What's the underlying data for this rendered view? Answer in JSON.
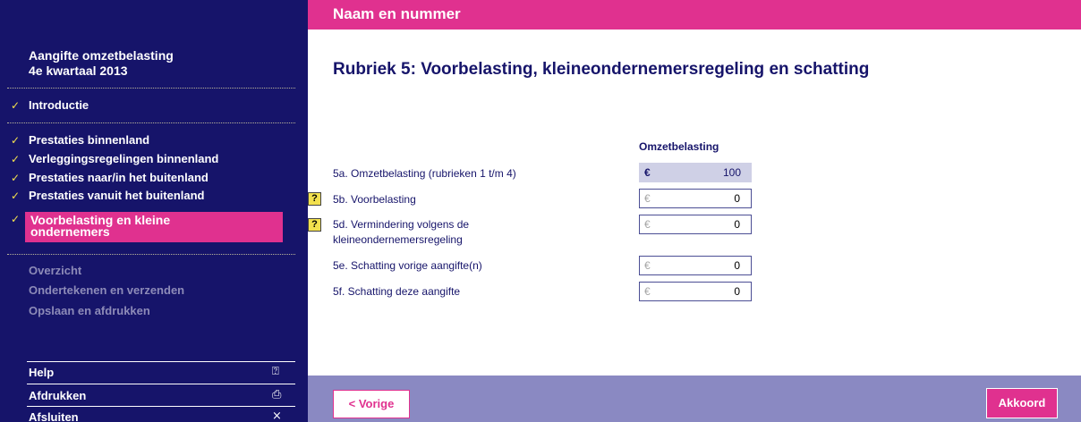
{
  "header": {
    "title": "Naam en nummer"
  },
  "sidebar": {
    "title_line1": "Aangifte omzetbelasting",
    "title_line2": "4e kwartaal 2013",
    "intro": "Introductie",
    "steps": [
      "Prestaties binnenland",
      "Verleggingsregelingen binnenland",
      "Prestaties naar/in het buitenland",
      "Prestaties vanuit het buitenland"
    ],
    "active_step": "Voorbelasting en kleine ondernemers",
    "check_icon": "checkmark-icon",
    "upcoming": [
      "Overzicht",
      "Ondertekenen en verzenden",
      "Opslaan en afdrukken"
    ],
    "bottom": [
      {
        "label": "Help",
        "icon": "help-icon",
        "glyph": "⍰"
      },
      {
        "label": "Afdrukken",
        "icon": "print-icon",
        "glyph": "⎙"
      },
      {
        "label": "Afsluiten",
        "icon": "close-icon",
        "glyph": "×"
      }
    ]
  },
  "main": {
    "heading": "Rubriek 5: Voorbelasting, kleineondernemersregeling en schatting",
    "column_header": "Omzetbelasting",
    "currency": "€",
    "help_glyph": "?",
    "rows": [
      {
        "label": "5a. Omzetbelasting (rubrieken 1 t/m 4)",
        "value": "100"
      },
      {
        "label": "5b. Voorbelasting",
        "value": "0"
      },
      {
        "label_line1": "5d. Vermindering volgens de",
        "label_line2": "kleineondernemersregeling",
        "value": "0"
      },
      {
        "label": "5e. Schatting vorige aangifte(n)",
        "value": "0"
      },
      {
        "label": "5f. Schatting deze aangifte",
        "value": "0"
      }
    ]
  },
  "footer": {
    "prev_label": "< Vorige",
    "ok_label": "Akkoord"
  },
  "colors": {
    "navy": "#16146a",
    "magenta": "#e0318f",
    "footer": "#8a89c2",
    "check": "#f2e04e"
  }
}
